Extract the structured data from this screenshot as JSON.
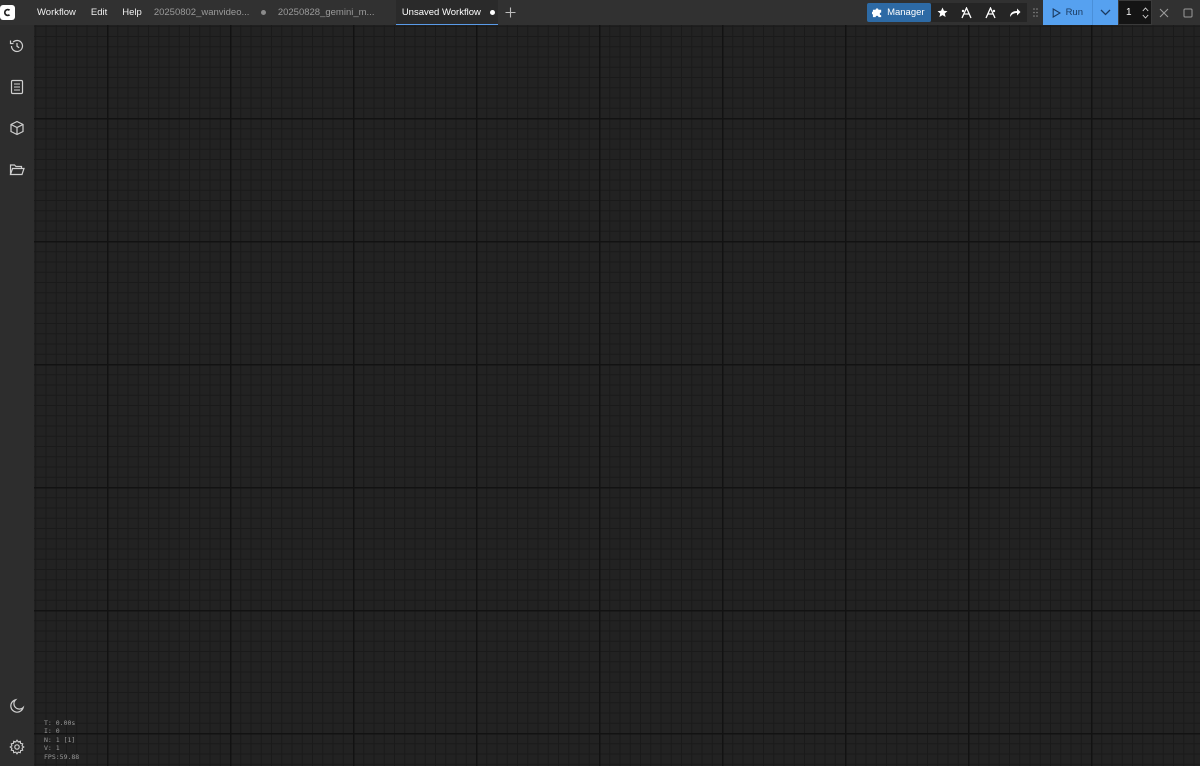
{
  "menu": {
    "items": [
      {
        "label": "Workflow"
      },
      {
        "label": "Edit"
      },
      {
        "label": "Help"
      }
    ]
  },
  "tabs": [
    {
      "label": "20250802_wanvideo...",
      "active": false
    },
    {
      "label": "20250828_gemini_m...",
      "active": false
    },
    {
      "label": "Unsaved Workflow",
      "active": true
    }
  ],
  "toolbar": {
    "manager_label": "Manager",
    "run_label": "Run",
    "queue_count": "1"
  },
  "sidebar": {
    "top_icons": [
      "history-icon",
      "document-icon",
      "cube-icon",
      "folder-open-icon"
    ],
    "bottom_icons": [
      "moon-icon",
      "gear-icon"
    ]
  },
  "stats": {
    "t": "T: 0.00s",
    "i": "I: 0",
    "n": "N: 1 [1]",
    "v": "V: 1",
    "fps": "FPS:59.88"
  },
  "colors": {
    "topbar_bg": "#313131",
    "sidebar_bg": "#2d2d2d",
    "canvas_bg": "#222222",
    "manager_bg": "#2d6aa5",
    "run_bg": "#56a1f0",
    "active_tab_underline": "#5a9be8"
  }
}
